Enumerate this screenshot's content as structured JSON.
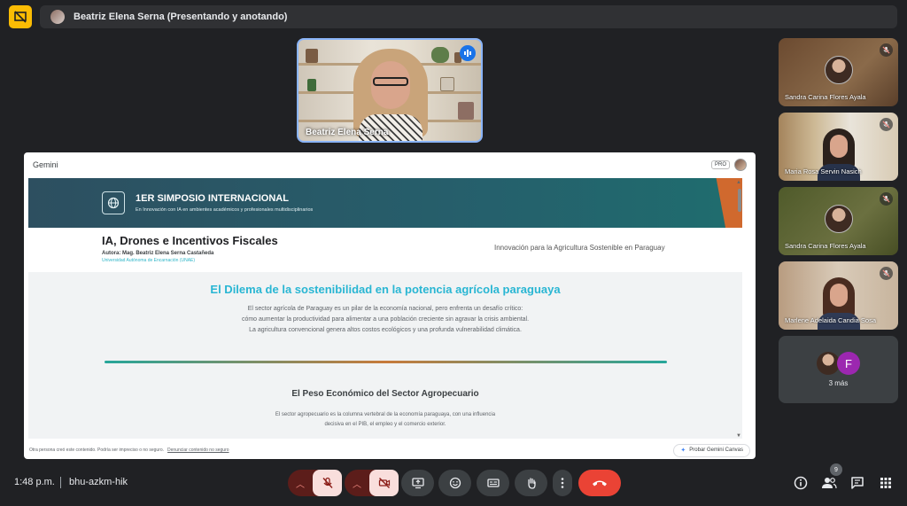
{
  "top": {
    "title": "Beatriz Elena Serna (Presentando y anotando)"
  },
  "presenter": {
    "name": "Beatriz Elena Serna"
  },
  "gemini": {
    "app_name": "Gemini",
    "pro_badge": "PRO",
    "banner_title": "1ER SIMPOSIO INTERNACIONAL",
    "banner_subtitle": "En Innovación con IA en ambientes académicos y profesionales multidisciplinarios",
    "doc_title": "IA, Drones e Incentivos Fiscales",
    "author": "Autora: Mag. Beatriz Elena Serna Castañeda",
    "university": "Universidad Autónoma de Encarnación (UNAE)",
    "tagline": "Innovación para la Agricultura Sostenible en Paraguay",
    "section1_title": "El Dilema de la sostenibilidad en la potencia agrícola paraguaya",
    "section1_lines": [
      "El sector agrícola de Paraguay es un pilar de la economía nacional, pero enfrenta un desafío crítico:",
      "cómo aumentar la productividad para alimentar a una población creciente sin agravar la crisis ambiental.",
      "La agricultura convencional genera altos costos ecológicos y una profunda vulnerabilidad climática."
    ],
    "section2_title": "El Peso Económico del Sector Agropecuario",
    "section2_lines": [
      "El sector agropecuario es la columna vertebral de la economía paraguaya, con una influencia",
      "decisiva en el PIB, el empleo y el comercio exterior."
    ],
    "footer_notice": "Otra persona creó este contenido. Podría ser impreciso o no seguro.",
    "footer_link": "Denunciar contenido no seguro",
    "canvas_button": "Probar Gemini Canvas"
  },
  "participants": [
    {
      "name": "Sandra Carina Flores Ayala",
      "muted": true
    },
    {
      "name": "Maria Rosa Servin Nasich",
      "muted": true
    },
    {
      "name": "Sandra Carina Flores Ayala",
      "muted": true
    },
    {
      "name": "Marlene Adelaida Candia Sosa",
      "muted": true
    }
  ],
  "more": {
    "initial": "F",
    "label": "3 más"
  },
  "bottom": {
    "time": "1:48 p.m.",
    "meeting_code": "bhu-azkm-hik",
    "people_count": "9"
  },
  "colors": {
    "accent_teal": "#29b6d3",
    "hangup_red": "#ea4335",
    "top_icon_yellow": "#fbbc04",
    "muted_control_bg": "#f9dedc"
  },
  "icons": [
    "presentation-off-icon",
    "mic-off-icon",
    "camera-off-icon",
    "present-screen-icon",
    "emoji-icon",
    "captions-icon",
    "raise-hand-icon",
    "more-options-icon",
    "hangup-icon",
    "info-icon",
    "people-icon",
    "chat-icon",
    "activities-icon",
    "globe-icon",
    "sparkle-icon"
  ]
}
